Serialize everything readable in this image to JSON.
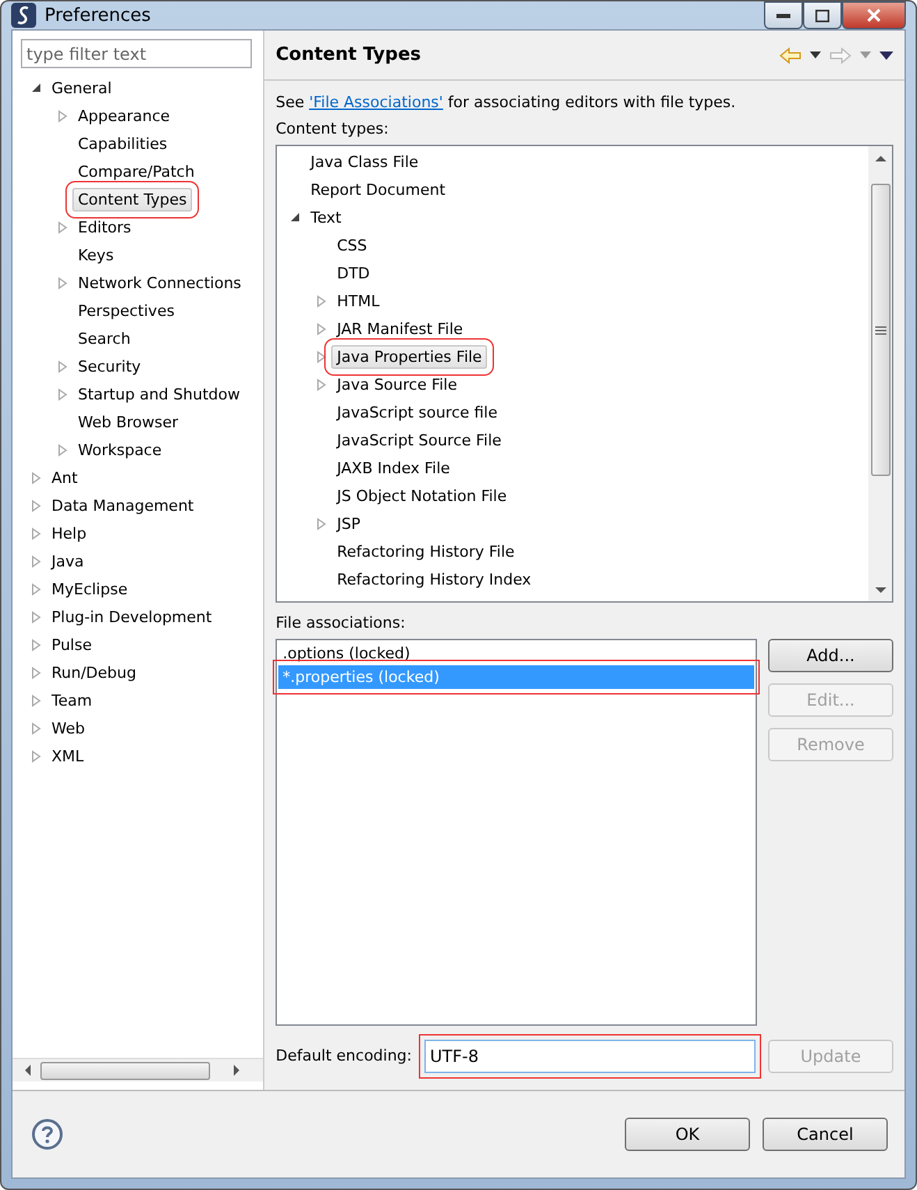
{
  "window": {
    "title": "Preferences"
  },
  "filter": {
    "placeholder": "type filter text"
  },
  "nav": [
    {
      "label": "General",
      "kind": "branch",
      "expanded": true,
      "selected": false,
      "highlighted": false,
      "children": [
        {
          "label": "Appearance",
          "kind": "branch",
          "expanded": false,
          "selected": false,
          "highlighted": false
        },
        {
          "label": "Capabilities",
          "kind": "leaf",
          "selected": false,
          "highlighted": false
        },
        {
          "label": "Compare/Patch",
          "kind": "leaf",
          "selected": false,
          "highlighted": false
        },
        {
          "label": "Content Types",
          "kind": "leaf",
          "selected": true,
          "highlighted": true
        },
        {
          "label": "Editors",
          "kind": "branch",
          "expanded": false,
          "selected": false,
          "highlighted": false
        },
        {
          "label": "Keys",
          "kind": "leaf",
          "selected": false,
          "highlighted": false
        },
        {
          "label": "Network Connections",
          "kind": "branch",
          "expanded": false,
          "selected": false,
          "highlighted": false
        },
        {
          "label": "Perspectives",
          "kind": "leaf",
          "selected": false,
          "highlighted": false
        },
        {
          "label": "Search",
          "kind": "leaf",
          "selected": false,
          "highlighted": false
        },
        {
          "label": "Security",
          "kind": "branch",
          "expanded": false,
          "selected": false,
          "highlighted": false
        },
        {
          "label": "Startup and Shutdow",
          "kind": "branch",
          "expanded": false,
          "selected": false,
          "highlighted": false
        },
        {
          "label": "Web Browser",
          "kind": "leaf",
          "selected": false,
          "highlighted": false
        },
        {
          "label": "Workspace",
          "kind": "branch",
          "expanded": false,
          "selected": false,
          "highlighted": false
        }
      ]
    },
    {
      "label": "Ant",
      "kind": "branch",
      "expanded": false,
      "selected": false,
      "highlighted": false
    },
    {
      "label": "Data Management",
      "kind": "branch",
      "expanded": false,
      "selected": false,
      "highlighted": false
    },
    {
      "label": "Help",
      "kind": "branch",
      "expanded": false,
      "selected": false,
      "highlighted": false
    },
    {
      "label": "Java",
      "kind": "branch",
      "expanded": false,
      "selected": false,
      "highlighted": false
    },
    {
      "label": "MyEclipse",
      "kind": "branch",
      "expanded": false,
      "selected": false,
      "highlighted": false
    },
    {
      "label": "Plug-in Development",
      "kind": "branch",
      "expanded": false,
      "selected": false,
      "highlighted": false
    },
    {
      "label": "Pulse",
      "kind": "branch",
      "expanded": false,
      "selected": false,
      "highlighted": false
    },
    {
      "label": "Run/Debug",
      "kind": "branch",
      "expanded": false,
      "selected": false,
      "highlighted": false
    },
    {
      "label": "Team",
      "kind": "branch",
      "expanded": false,
      "selected": false,
      "highlighted": false
    },
    {
      "label": "Web",
      "kind": "branch",
      "expanded": false,
      "selected": false,
      "highlighted": false
    },
    {
      "label": "XML",
      "kind": "branch",
      "expanded": false,
      "selected": false,
      "highlighted": false
    }
  ],
  "page": {
    "title": "Content Types",
    "intro_before": "See ",
    "intro_link": "'File Associations'",
    "intro_after": " for associating editors with file types.",
    "content_types_label": "Content types:",
    "content_types": [
      {
        "label": "Java Class File",
        "kind": "leaf",
        "selected": false,
        "highlighted": false
      },
      {
        "label": "Report Document",
        "kind": "leaf",
        "selected": false,
        "highlighted": false
      },
      {
        "label": "Text",
        "kind": "branch",
        "expanded": true,
        "selected": false,
        "highlighted": false,
        "children": [
          {
            "label": "CSS",
            "kind": "leaf",
            "selected": false,
            "highlighted": false
          },
          {
            "label": "DTD",
            "kind": "leaf",
            "selected": false,
            "highlighted": false
          },
          {
            "label": "HTML",
            "kind": "branch",
            "expanded": false,
            "selected": false,
            "highlighted": false
          },
          {
            "label": "JAR Manifest File",
            "kind": "branch",
            "expanded": false,
            "selected": false,
            "highlighted": false
          },
          {
            "label": "Java Properties File",
            "kind": "branch",
            "expanded": false,
            "selected": true,
            "highlighted": true
          },
          {
            "label": "Java Source File",
            "kind": "branch",
            "expanded": false,
            "selected": false,
            "highlighted": false
          },
          {
            "label": "JavaScript source file",
            "kind": "leaf",
            "selected": false,
            "highlighted": false
          },
          {
            "label": "JavaScript Source File",
            "kind": "leaf",
            "selected": false,
            "highlighted": false
          },
          {
            "label": "JAXB Index File",
            "kind": "leaf",
            "selected": false,
            "highlighted": false
          },
          {
            "label": "JS Object Notation File",
            "kind": "leaf",
            "selected": false,
            "highlighted": false
          },
          {
            "label": "JSP",
            "kind": "branch",
            "expanded": false,
            "selected": false,
            "highlighted": false
          },
          {
            "label": "Refactoring History File",
            "kind": "leaf",
            "selected": false,
            "highlighted": false
          },
          {
            "label": "Refactoring History Index",
            "kind": "leaf",
            "selected": false,
            "highlighted": false
          }
        ]
      }
    ],
    "file_associations_label": "File associations:",
    "file_associations": [
      {
        "label": ".options (locked)",
        "selected": false,
        "highlighted": false
      },
      {
        "label": "*.properties (locked)",
        "selected": true,
        "highlighted": true
      }
    ],
    "side_buttons": [
      {
        "label": "Add...",
        "disabled": false
      },
      {
        "label": "Edit...",
        "disabled": true
      },
      {
        "label": "Remove",
        "disabled": true
      }
    ],
    "encoding_label": "Default encoding:",
    "encoding_value": "UTF-8",
    "encoding_highlighted": true,
    "update_button": {
      "label": "Update",
      "disabled": true
    }
  },
  "buttons": [
    "OK",
    "Cancel"
  ]
}
